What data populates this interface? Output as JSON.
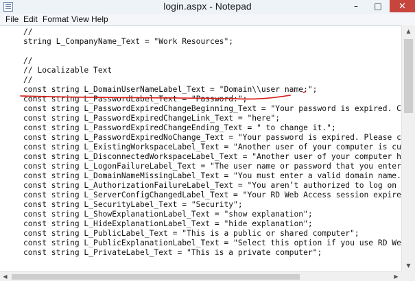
{
  "window": {
    "title": "login.aspx - Notepad",
    "controls": {
      "minimize": "–",
      "maximize": "□",
      "close": "✕"
    }
  },
  "menu": [
    "File",
    "Edit",
    "Format",
    "View",
    "Help"
  ],
  "editor": {
    "lines": [
      "//",
      "string L_CompanyName_Text = \"Work Resources\";",
      "",
      "//",
      "// Localizable Text",
      "//",
      "const string L_DomainUserNameLabel_Text = \"Domain\\\\user name:\";",
      "const string L_PasswordLabel_Text = \"Password:\";",
      "const string L_PasswordExpiredChangeBeginning_Text = \"Your password is expired. Click",
      "const string L_PasswordExpiredChangeLink_Text = \"here\";",
      "const string L_PasswordExpiredChangeEnding_Text = \" to change it.\";",
      "const string L_PasswordExpiredNoChange_Text = \"Your password is expired. Please contac",
      "const string L_ExistingWorkspaceLabel_Text = \"Another user of your computer is currenti",
      "const string L_DisconnectedWorkspaceLabel_Text = \"Another user of your computer has di",
      "const string L_LogonFailureLabel_Text = \"The user name or password that you entered is",
      "const string L_DomainNameMissingLabel_Text = \"You must enter a valid domain name.\";",
      "const string L_AuthorizationFailureLabel_Text = \"You aren’t authorized to log on to th",
      "const string L_ServerConfigChangedLabel_Text = \"Your RD Web Access session expired due",
      "const string L_SecurityLabel_Text = \"Security\";",
      "const string L_ShowExplanationLabel_Text = \"show explanation\";",
      "const string L_HideExplanationLabel_Text = \"hide explanation\";",
      "const string L_PublicLabel_Text = \"This is a public or shared computer\";",
      "const string L_PublicExplanationLabel_Text = \"Select this option if you use RD Web Acc",
      "const string L_PrivateLabel_Text = \"This is a private computer\";"
    ],
    "highlight_color": "#d9221b"
  },
  "scrollbars": {
    "up": "▲",
    "down": "▼",
    "left": "◀",
    "right": "▶"
  }
}
